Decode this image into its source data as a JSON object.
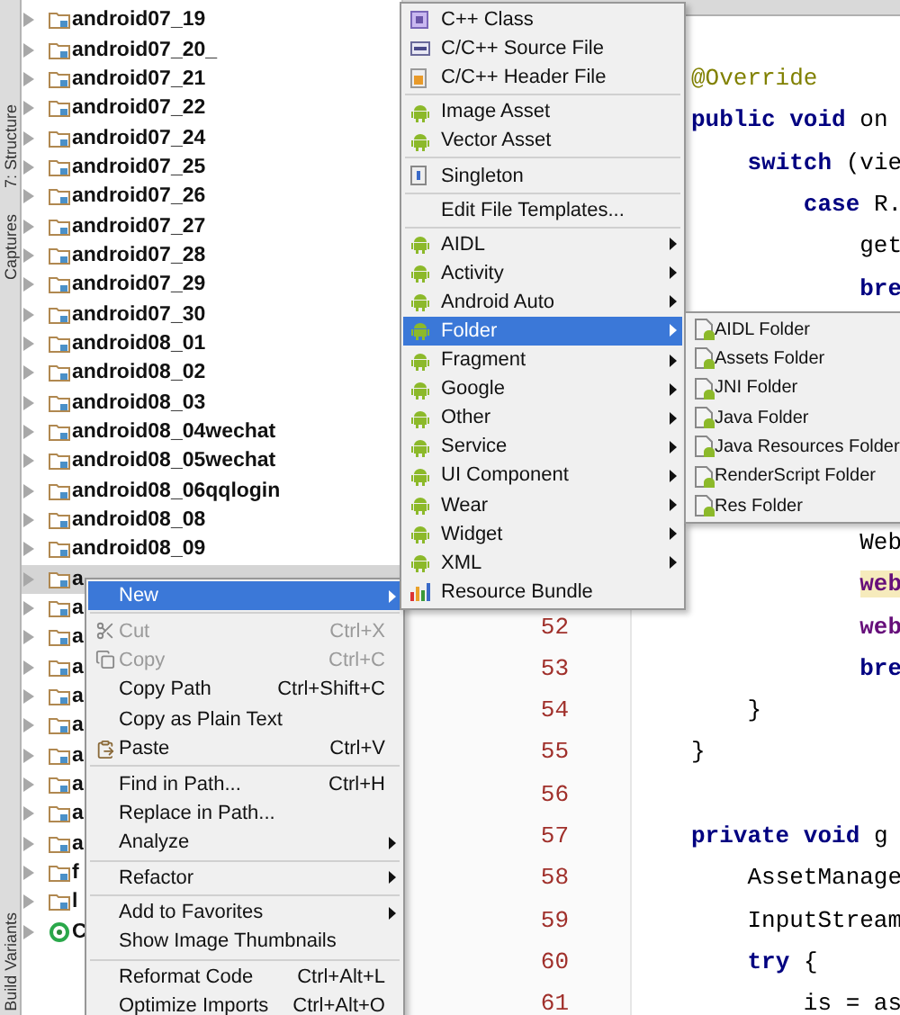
{
  "side_tabs": [
    {
      "label": "7: Structure"
    },
    {
      "label": "Captures"
    },
    {
      "label": "Build Variants"
    }
  ],
  "project_tree": {
    "items": [
      {
        "label": "android07_19",
        "kind": "folder",
        "selected": false
      },
      {
        "label": "android07_20_",
        "kind": "folder",
        "selected": false
      },
      {
        "label": "android07_21",
        "kind": "folder",
        "selected": false
      },
      {
        "label": "android07_22",
        "kind": "folder",
        "selected": false
      },
      {
        "label": "android07_24",
        "kind": "folder",
        "selected": false
      },
      {
        "label": "android07_25",
        "kind": "folder",
        "selected": false
      },
      {
        "label": "android07_26",
        "kind": "folder",
        "selected": false
      },
      {
        "label": "android07_27",
        "kind": "folder",
        "selected": false
      },
      {
        "label": "android07_28",
        "kind": "folder",
        "selected": false
      },
      {
        "label": "android07_29",
        "kind": "folder",
        "selected": false
      },
      {
        "label": "android07_30",
        "kind": "folder",
        "selected": false
      },
      {
        "label": "android08_01",
        "kind": "folder",
        "selected": false
      },
      {
        "label": "android08_02",
        "kind": "folder",
        "selected": false
      },
      {
        "label": "android08_03",
        "kind": "folder",
        "selected": false
      },
      {
        "label": "android08_04wechat",
        "kind": "folder",
        "selected": false
      },
      {
        "label": "android08_05wechat",
        "kind": "folder",
        "selected": false
      },
      {
        "label": "android08_06qqlogin",
        "kind": "folder",
        "selected": false
      },
      {
        "label": "android08_08",
        "kind": "folder",
        "selected": false
      },
      {
        "label": "android08_09",
        "kind": "folder",
        "selected": false
      },
      {
        "label": "a",
        "kind": "folder",
        "selected": true
      },
      {
        "label": "a",
        "kind": "folder",
        "selected": false
      },
      {
        "label": "a",
        "kind": "folder",
        "selected": false
      },
      {
        "label": "a",
        "kind": "folder",
        "selected": false
      },
      {
        "label": "a",
        "kind": "folder",
        "selected": false
      },
      {
        "label": "a",
        "kind": "folder",
        "selected": false
      },
      {
        "label": "a",
        "kind": "folder",
        "selected": false
      },
      {
        "label": "a",
        "kind": "folder",
        "selected": false
      },
      {
        "label": "a",
        "kind": "folder",
        "selected": false
      },
      {
        "label": "a",
        "kind": "folder",
        "selected": false
      },
      {
        "label": "f",
        "kind": "folder",
        "selected": false
      },
      {
        "label": "l",
        "kind": "folder",
        "selected": false
      },
      {
        "label": "C",
        "kind": "module",
        "selected": false
      }
    ]
  },
  "editor": {
    "upper_lines": [
      {
        "tokens": [
          {
            "text": "@Override",
            "kind": "annotation"
          }
        ]
      },
      {
        "tokens": [
          {
            "text": "public void",
            "kind": "keyword"
          },
          {
            "text": " on",
            "kind": "plain"
          }
        ]
      },
      {
        "tokens": [
          {
            "text": "    switch",
            "kind": "keyword"
          },
          {
            "text": " (vie",
            "kind": "plain"
          }
        ]
      },
      {
        "tokens": [
          {
            "text": "        case",
            "kind": "keyword"
          },
          {
            "text": " R.",
            "kind": "plain"
          }
        ]
      },
      {
        "tokens": [
          {
            "text": "            get",
            "kind": "plain"
          }
        ]
      },
      {
        "tokens": [
          {
            "text": "            bre",
            "kind": "keyword"
          }
        ]
      }
    ],
    "lower_lines": [
      {
        "tokens": [
          {
            "text": "            Web",
            "kind": "plain"
          }
        ]
      },
      {
        "tokens": [
          {
            "text": "            web",
            "kind": "highlight"
          }
        ]
      },
      {
        "number": "52",
        "tokens": [
          {
            "text": "            web",
            "kind": "field"
          }
        ]
      },
      {
        "number": "53",
        "tokens": [
          {
            "text": "            bre",
            "kind": "keyword"
          }
        ]
      },
      {
        "number": "54",
        "tokens": [
          {
            "text": "    }",
            "kind": "plain"
          }
        ]
      },
      {
        "number": "55",
        "tokens": [
          {
            "text": "}",
            "kind": "plain"
          }
        ]
      },
      {
        "number": "56"
      },
      {
        "number": "57",
        "tokens": [
          {
            "text": "private void",
            "kind": "keyword"
          },
          {
            "text": " g",
            "kind": "plain"
          }
        ]
      },
      {
        "number": "58",
        "tokens": [
          {
            "text": "    AssetManage",
            "kind": "plain"
          }
        ]
      },
      {
        "number": "59",
        "tokens": [
          {
            "text": "    InputStream",
            "kind": "plain"
          }
        ]
      },
      {
        "number": "60",
        "tokens": [
          {
            "text": "    try",
            "kind": "keyword"
          },
          {
            "text": " {",
            "kind": "plain"
          }
        ]
      },
      {
        "number": "61",
        "tokens": [
          {
            "text": "        is = as",
            "kind": "plain"
          }
        ]
      }
    ]
  },
  "context_menu": {
    "items": [
      {
        "kind": "plain",
        "label": "New",
        "submenu": true,
        "disabled": false,
        "selected": true
      },
      {
        "kind": "separator"
      },
      {
        "kind": "cut",
        "label": "Cut",
        "shortcut": "Ctrl+X",
        "submenu": false,
        "disabled": true,
        "selected": false
      },
      {
        "kind": "copy",
        "label": "Copy",
        "shortcut": "Ctrl+C",
        "submenu": false,
        "disabled": true,
        "selected": false
      },
      {
        "kind": "plain",
        "label": "Copy Path",
        "shortcut": "Ctrl+Shift+C",
        "submenu": false,
        "disabled": false,
        "selected": false
      },
      {
        "kind": "plain",
        "label": "Copy as Plain Text",
        "submenu": false,
        "disabled": false,
        "selected": false
      },
      {
        "kind": "paste",
        "label": "Paste",
        "shortcut": "Ctrl+V",
        "submenu": false,
        "disabled": false,
        "selected": false
      },
      {
        "kind": "separator"
      },
      {
        "kind": "plain",
        "label": "Find in Path...",
        "shortcut": "Ctrl+H",
        "submenu": false,
        "disabled": false,
        "selected": false
      },
      {
        "kind": "plain",
        "label": "Replace in Path...",
        "submenu": false,
        "disabled": false,
        "selected": false
      },
      {
        "kind": "plain",
        "label": "Analyze",
        "submenu": true,
        "disabled": false,
        "selected": false
      },
      {
        "kind": "separator"
      },
      {
        "kind": "plain",
        "label": "Refactor",
        "submenu": true,
        "disabled": false,
        "selected": false
      },
      {
        "kind": "separator"
      },
      {
        "kind": "plain",
        "label": "Add to Favorites",
        "submenu": true,
        "disabled": false,
        "selected": false
      },
      {
        "kind": "plain",
        "label": "Show Image Thumbnails",
        "submenu": false,
        "disabled": false,
        "selected": false
      },
      {
        "kind": "separator"
      },
      {
        "kind": "plain",
        "label": "Reformat Code",
        "shortcut": "Ctrl+Alt+L",
        "submenu": false,
        "disabled": false,
        "selected": false
      },
      {
        "kind": "plain",
        "label": "Optimize Imports",
        "shortcut": "Ctrl+Alt+O",
        "submenu": false,
        "disabled": false,
        "selected": false
      }
    ]
  },
  "new_menu": {
    "items": [
      {
        "kind": "class",
        "label": "C++ Class",
        "submenu": false,
        "selected": false
      },
      {
        "kind": "source",
        "label": "C/C++ Source File",
        "submenu": false,
        "selected": false
      },
      {
        "kind": "header",
        "label": "C/C++ Header File",
        "submenu": false,
        "selected": false
      },
      {
        "kind": "separator"
      },
      {
        "kind": "android",
        "label": "Image Asset",
        "submenu": false,
        "selected": false
      },
      {
        "kind": "android",
        "label": "Vector Asset",
        "submenu": false,
        "selected": false
      },
      {
        "kind": "separator"
      },
      {
        "kind": "singleton",
        "label": "Singleton",
        "submenu": false,
        "selected": false
      },
      {
        "kind": "separator"
      },
      {
        "kind": "plain",
        "label": "Edit File Templates...",
        "submenu": false,
        "selected": false
      },
      {
        "kind": "separator"
      },
      {
        "kind": "android",
        "label": "AIDL",
        "submenu": true,
        "selected": false
      },
      {
        "kind": "android",
        "label": "Activity",
        "submenu": true,
        "selected": false
      },
      {
        "kind": "android",
        "label": "Android Auto",
        "submenu": true,
        "selected": false
      },
      {
        "kind": "android",
        "label": "Folder",
        "submenu": true,
        "selected": true
      },
      {
        "kind": "android",
        "label": "Fragment",
        "submenu": true,
        "selected": false
      },
      {
        "kind": "android",
        "label": "Google",
        "submenu": true,
        "selected": false
      },
      {
        "kind": "android",
        "label": "Other",
        "submenu": true,
        "selected": false
      },
      {
        "kind": "android",
        "label": "Service",
        "submenu": true,
        "selected": false
      },
      {
        "kind": "android",
        "label": "UI Component",
        "submenu": true,
        "selected": false
      },
      {
        "kind": "android",
        "label": "Wear",
        "submenu": true,
        "selected": false
      },
      {
        "kind": "android",
        "label": "Widget",
        "submenu": true,
        "selected": false
      },
      {
        "kind": "android",
        "label": "XML",
        "submenu": true,
        "selected": false
      },
      {
        "kind": "bundle",
        "label": "Resource Bundle",
        "submenu": false,
        "selected": false
      }
    ]
  },
  "folder_menu": {
    "items": [
      {
        "kind": "androidfile",
        "label": "AIDL Folder",
        "selected": false
      },
      {
        "kind": "androidfile",
        "label": "Assets Folder",
        "selected": false
      },
      {
        "kind": "androidfile",
        "label": "JNI Folder",
        "selected": false
      },
      {
        "kind": "androidfile",
        "label": "Java Folder",
        "selected": false
      },
      {
        "kind": "androidfile",
        "label": "Java Resources Folder",
        "selected": false
      },
      {
        "kind": "androidfile",
        "label": "RenderScript Folder",
        "selected": false
      },
      {
        "kind": "androidfile",
        "label": "Res Folder",
        "selected": false
      }
    ]
  }
}
